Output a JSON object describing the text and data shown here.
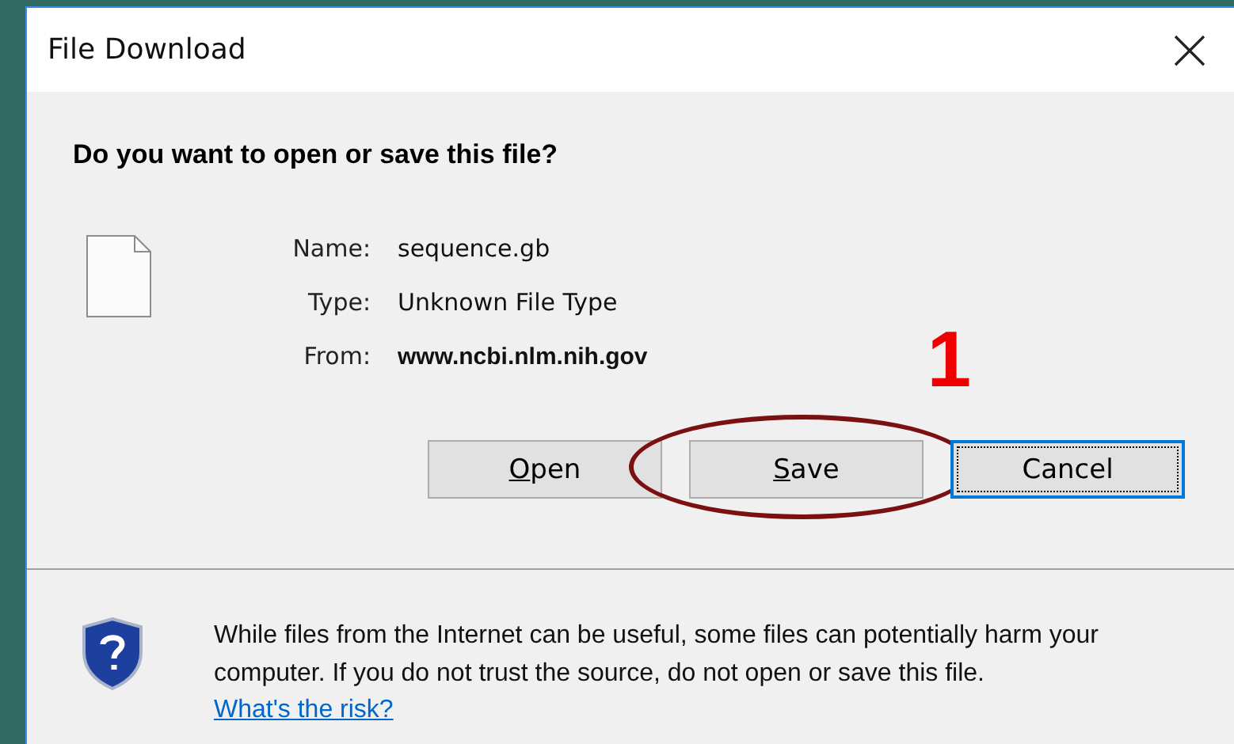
{
  "window": {
    "title": "File Download"
  },
  "question": "Do you want to open or save this file?",
  "fields": [
    {
      "label": "Name:",
      "value": "sequence.gb",
      "bold": false
    },
    {
      "label": "Type:",
      "value": "Unknown File Type",
      "bold": false
    },
    {
      "label": "From:",
      "value": "www.ncbi.nlm.nih.gov",
      "bold": true
    }
  ],
  "buttons": [
    {
      "label": "Open",
      "mnemonic": true,
      "default": false,
      "circled": false
    },
    {
      "label": "Save",
      "mnemonic": true,
      "default": false,
      "circled": true
    },
    {
      "label": "Cancel",
      "mnemonic": false,
      "default": true,
      "circled": false
    }
  ],
  "annotation": {
    "label": "1"
  },
  "warning": {
    "text": "While files from the Internet can be useful, some files can potentially harm your computer. If you do not trust the source, do not open or save this file.",
    "link": "What's the risk?"
  }
}
